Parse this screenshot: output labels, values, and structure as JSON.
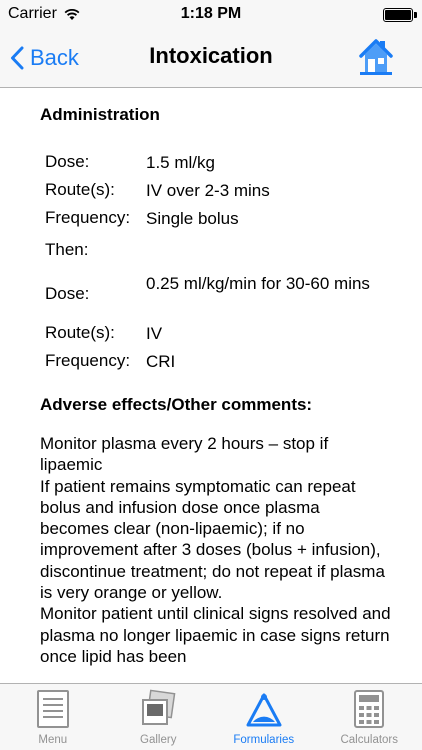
{
  "status_bar": {
    "carrier": "Carrier",
    "time": "1:18 PM",
    "battery_level": 1.0
  },
  "nav": {
    "back_label": "Back",
    "title": "Intoxication",
    "home_icon": "home-icon"
  },
  "administration": {
    "heading": "Administration",
    "rows": [
      {
        "label": "Dose:",
        "value": "1.5 ml/kg"
      },
      {
        "label": "Route(s):",
        "value": "IV over 2-3 mins"
      },
      {
        "label": "Frequency:",
        "value": "Single bolus"
      },
      {
        "label": "Then:",
        "value": ""
      },
      {
        "label": "Dose:",
        "value": "0.25 ml/kg/min for 30-60 mins"
      },
      {
        "label": "Route(s):",
        "value": "IV"
      },
      {
        "label": "Frequency:",
        "value": "CRI"
      }
    ]
  },
  "adverse": {
    "heading": "Adverse effects/Other comments:",
    "paragraphs": [
      "Monitor plasma every 2 hours – stop if lipaemic",
      "If patient remains symptomatic can repeat bolus and infusion dose once plasma becomes clear (non-lipaemic); if no improvement after 3 doses (bolus + infusion), discontinue treatment; do not repeat if plasma is very orange or yellow.",
      "Monitor patient until clinical signs resolved and plasma no longer lipaemic in case signs return once lipid has been"
    ]
  },
  "tabs": [
    {
      "label": "Menu",
      "icon": "menu-icon",
      "active": false
    },
    {
      "label": "Gallery",
      "icon": "gallery-icon",
      "active": false
    },
    {
      "label": "Formularies",
      "icon": "formularies-icon",
      "active": true
    },
    {
      "label": "Calculators",
      "icon": "calculator-icon",
      "active": false
    }
  ],
  "colors": {
    "accent": "#1a7cf4",
    "inactive_tab": "#929292",
    "bar_background": "#f7f7f7"
  }
}
